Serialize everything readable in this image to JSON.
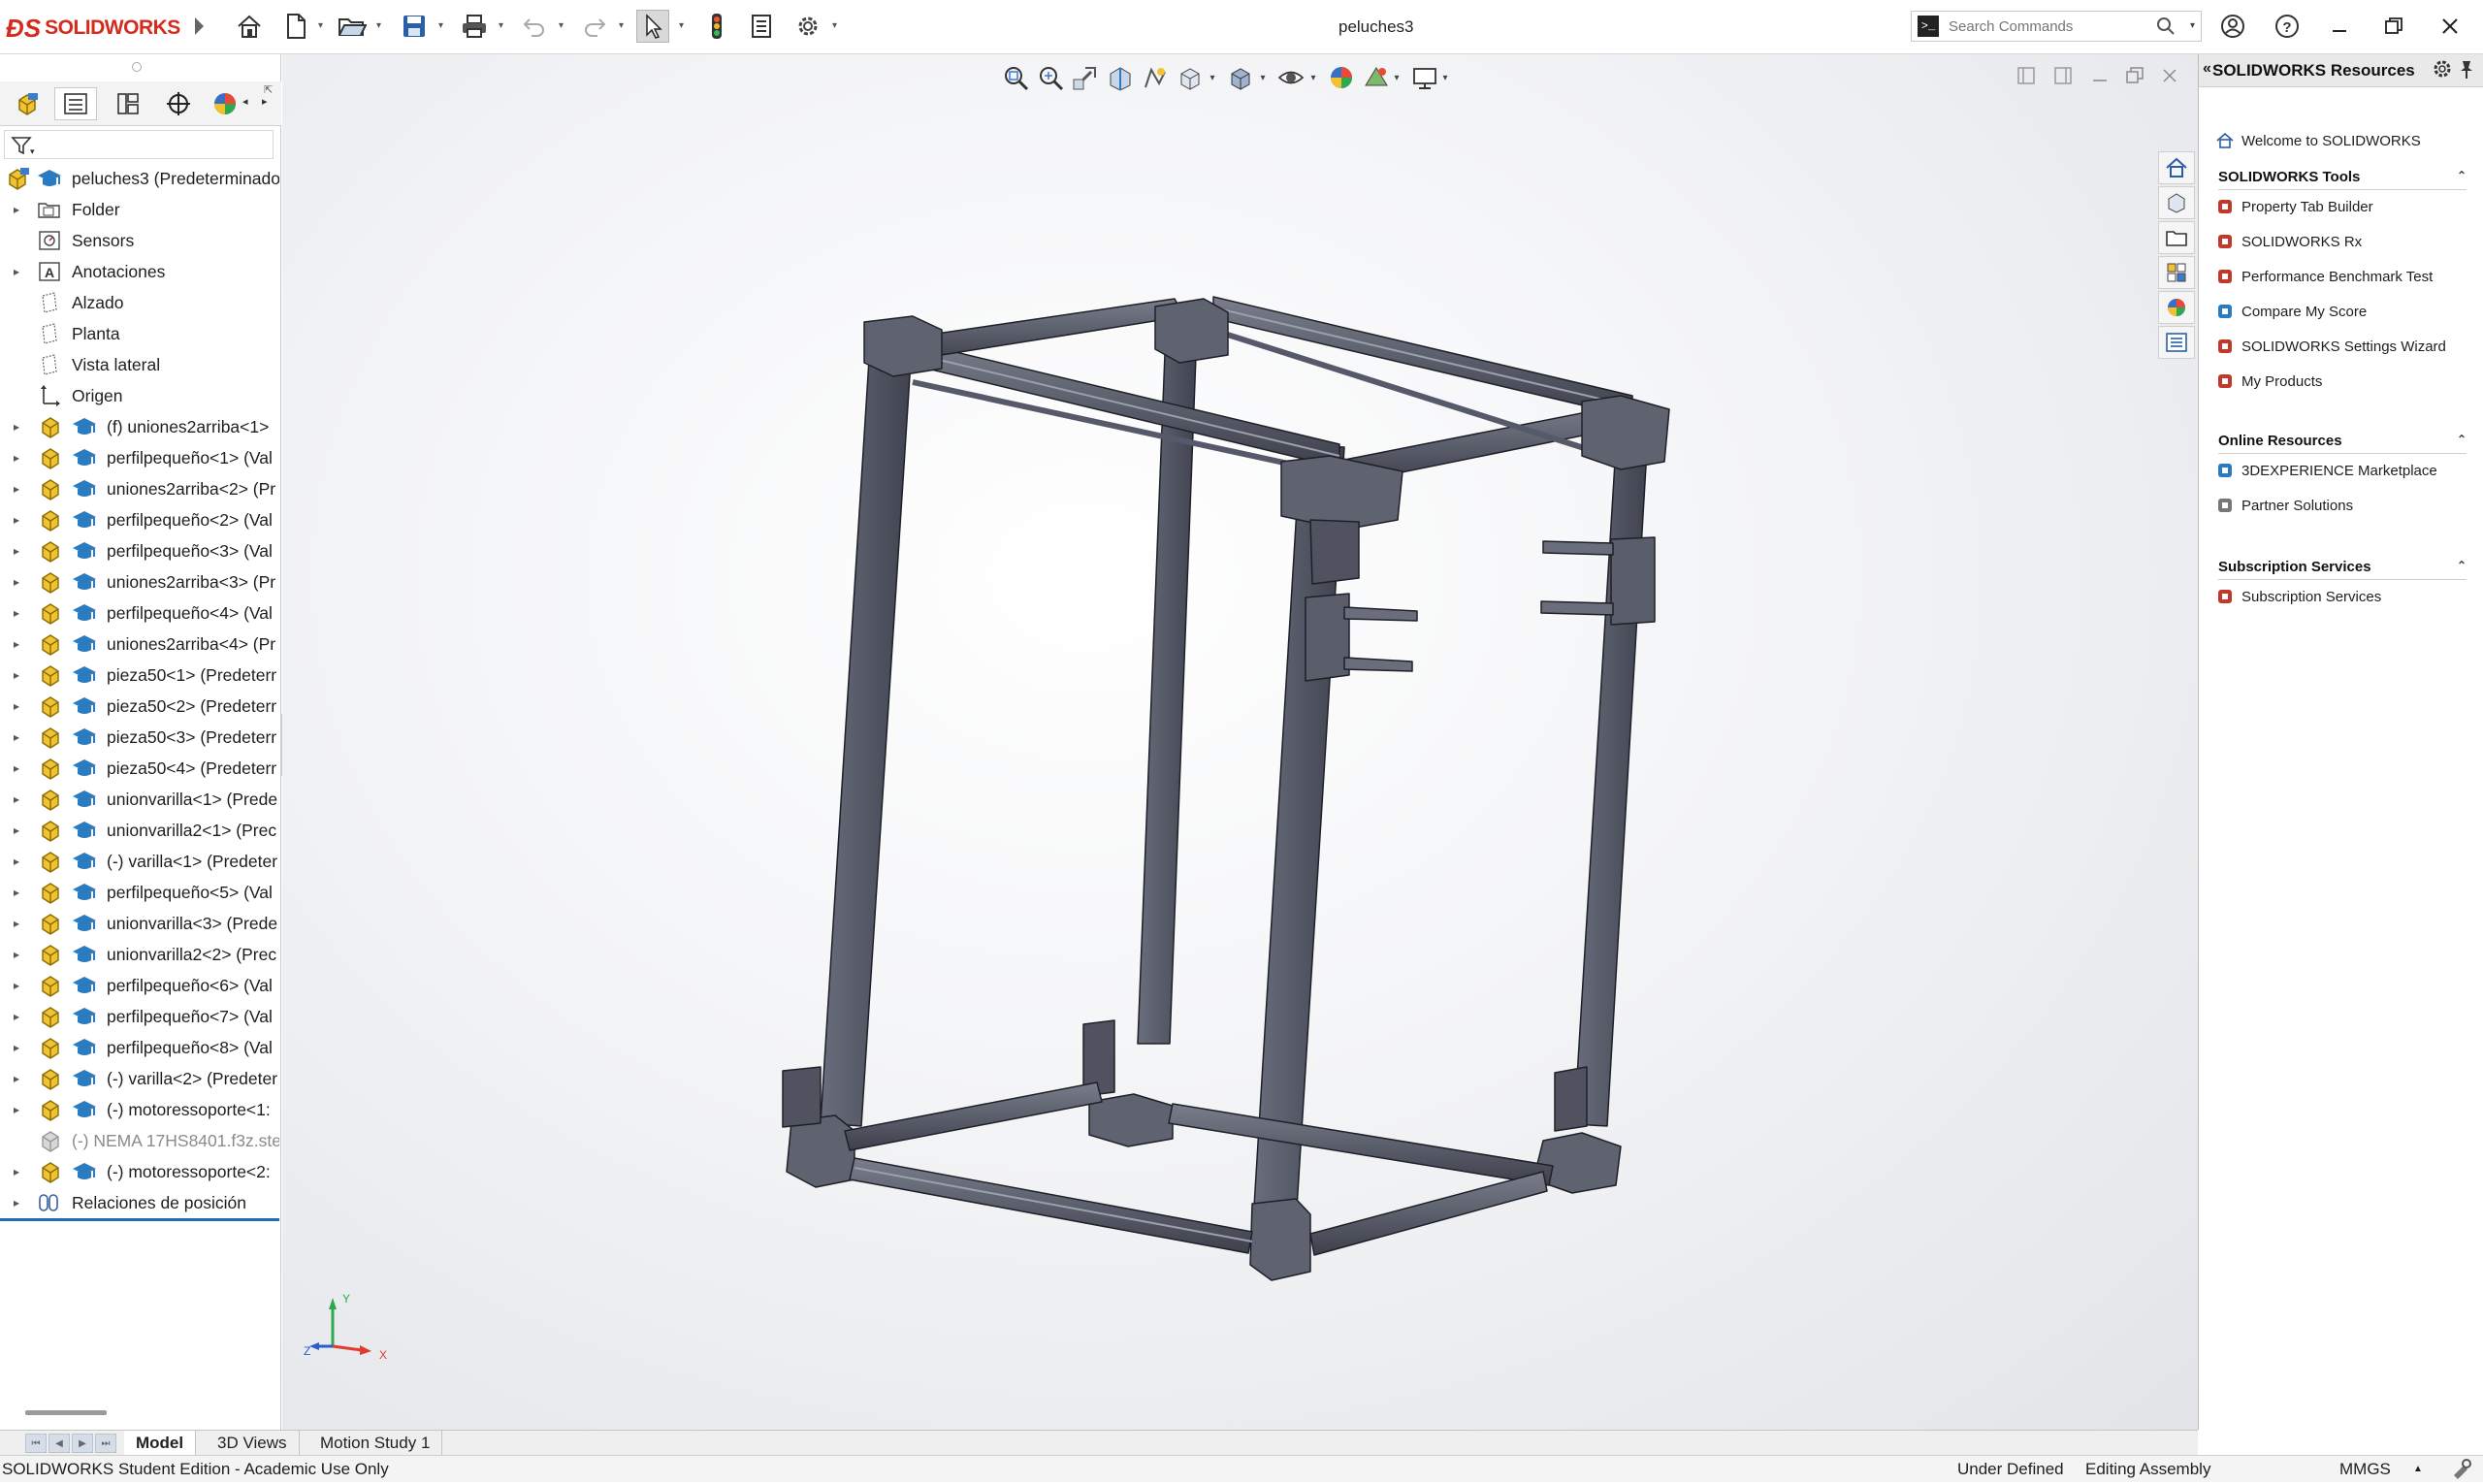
{
  "app": {
    "brand": "SOLIDWORKS",
    "document_title": "peluches3"
  },
  "toolbar": {
    "icons": [
      "home-icon",
      "new-document-icon",
      "open-icon",
      "save-icon",
      "print-icon",
      "undo-icon",
      "redo-icon",
      "select-icon",
      "rebuild-icon",
      "file-properties-icon",
      "options-icon"
    ]
  },
  "search": {
    "placeholder": "Search Commands",
    "command_glyph": ">_"
  },
  "feature_tree": {
    "root": "peluches3  (Predeterminado",
    "items": [
      {
        "label": "Folder",
        "type": "folder",
        "expandable": true
      },
      {
        "label": "Sensors",
        "type": "sensor",
        "expandable": false
      },
      {
        "label": "Anotaciones",
        "type": "annotation",
        "expandable": true
      },
      {
        "label": "Alzado",
        "type": "plane",
        "expandable": false
      },
      {
        "label": "Planta",
        "type": "plane",
        "expandable": false
      },
      {
        "label": "Vista lateral",
        "type": "plane",
        "expandable": false
      },
      {
        "label": "Origen",
        "type": "origin",
        "expandable": false
      },
      {
        "label": "(f) uniones2arriba<1>",
        "type": "part",
        "expandable": true
      },
      {
        "label": "perfilpequeño<1> (Val",
        "type": "part",
        "expandable": true
      },
      {
        "label": "uniones2arriba<2> (Pr",
        "type": "part",
        "expandable": true
      },
      {
        "label": "perfilpequeño<2> (Val",
        "type": "part",
        "expandable": true
      },
      {
        "label": "perfilpequeño<3> (Val",
        "type": "part",
        "expandable": true
      },
      {
        "label": "uniones2arriba<3> (Pr",
        "type": "part",
        "expandable": true
      },
      {
        "label": "perfilpequeño<4> (Val",
        "type": "part",
        "expandable": true
      },
      {
        "label": "uniones2arriba<4> (Pr",
        "type": "part",
        "expandable": true
      },
      {
        "label": "pieza50<1> (Predeterr",
        "type": "part",
        "expandable": true
      },
      {
        "label": "pieza50<2> (Predeterr",
        "type": "part",
        "expandable": true
      },
      {
        "label": "pieza50<3> (Predeterr",
        "type": "part",
        "expandable": true
      },
      {
        "label": "pieza50<4> (Predeterr",
        "type": "part",
        "expandable": true
      },
      {
        "label": "unionvarilla<1> (Prede",
        "type": "part",
        "expandable": true
      },
      {
        "label": "unionvarilla2<1> (Prec",
        "type": "part",
        "expandable": true
      },
      {
        "label": "(-) varilla<1> (Predeter",
        "type": "part",
        "expandable": true
      },
      {
        "label": "perfilpequeño<5> (Val",
        "type": "part",
        "expandable": true
      },
      {
        "label": "unionvarilla<3> (Prede",
        "type": "part",
        "expandable": true
      },
      {
        "label": "unionvarilla2<2> (Prec",
        "type": "part",
        "expandable": true
      },
      {
        "label": "perfilpequeño<6> (Val",
        "type": "part",
        "expandable": true
      },
      {
        "label": "perfilpequeño<7> (Val",
        "type": "part",
        "expandable": true
      },
      {
        "label": "perfilpequeño<8> (Val",
        "type": "part",
        "expandable": true
      },
      {
        "label": "(-) varilla<2> (Predeter",
        "type": "part",
        "expandable": true
      },
      {
        "label": "(-) motoressoporte<1:",
        "type": "part",
        "expandable": true
      },
      {
        "label": "(-) NEMA 17HS8401.f3z.ste",
        "type": "suppressed",
        "expandable": false
      },
      {
        "label": "(-) motoressoporte<2:",
        "type": "part",
        "expandable": true
      },
      {
        "label": "Relaciones de posición",
        "type": "mates",
        "expandable": true
      }
    ]
  },
  "triad": {
    "x": "X",
    "y": "Y",
    "z": "Z"
  },
  "task_pane": {
    "title": "SOLIDWORKS Resources",
    "welcome": "Welcome to SOLIDWORKS",
    "sections": [
      {
        "title": "SOLIDWORKS Tools",
        "links": [
          "Property Tab Builder",
          "SOLIDWORKS Rx",
          "Performance Benchmark Test",
          "Compare My Score",
          "SOLIDWORKS Settings Wizard",
          "My Products"
        ]
      },
      {
        "title": "Online Resources",
        "links": [
          "3DEXPERIENCE Marketplace",
          "Partner Solutions"
        ]
      },
      {
        "title": "Subscription Services",
        "links": [
          "Subscription Services"
        ]
      }
    ]
  },
  "bottom_tabs": [
    "Model",
    "3D Views",
    "Motion Study 1"
  ],
  "status": {
    "edition": "SOLIDWORKS Student Edition - Academic Use Only",
    "state": "Under Defined",
    "mode": "Editing Assembly",
    "units": "MMGS",
    "units_caret": "▲"
  },
  "colors": {
    "brand": "#d52b1e",
    "part_body": "#5a5d6b",
    "accent_blue": "#1f6bb5"
  }
}
